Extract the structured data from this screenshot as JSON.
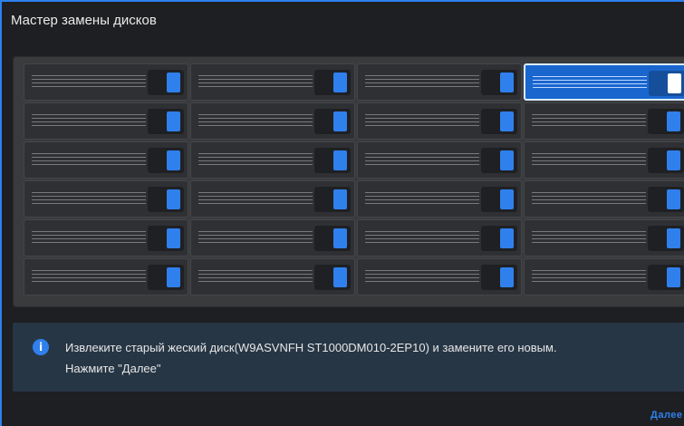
{
  "window": {
    "title": "Мастер замены дисков"
  },
  "bays": {
    "rows": 6,
    "columns": 4,
    "selected": {
      "row": 0,
      "column": 3
    }
  },
  "info": {
    "icon": "info-icon",
    "line1": "Извлеките старый жеский диск(W9ASVNFH ST1000DM010-2EP10) и замените его новым.",
    "line2": "Нажмите \"Далее\""
  },
  "footer": {
    "next_label": "Далее"
  },
  "colors": {
    "accent": "#2f80ed",
    "selected_tray": "#1a66cf",
    "info_background": "#273645"
  }
}
